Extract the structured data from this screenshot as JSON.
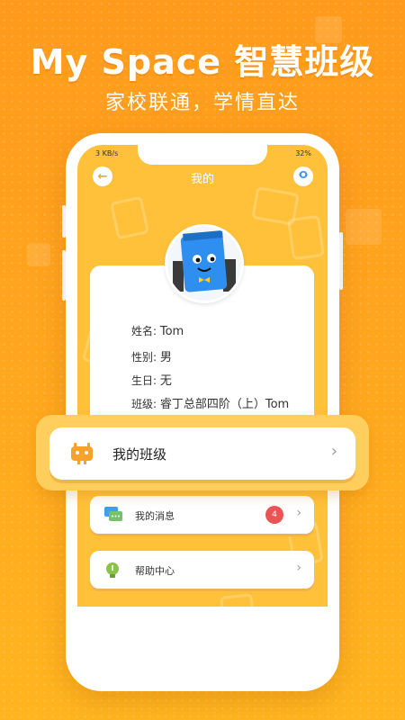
{
  "headline": "My Space 智慧班级",
  "subline": "家校联通，学情直达",
  "status": {
    "left": "3 KB/s",
    "right": "32%"
  },
  "nav": {
    "title": "我的",
    "back_icon": "back-arrow-icon",
    "settings_icon": "gear-icon"
  },
  "profile": {
    "name_label": "姓名:",
    "name_value": "Tom",
    "gender_label": "性别:",
    "gender_value": "男",
    "birthday_label": "生日:",
    "birthday_value": "无",
    "class_label": "班级:",
    "class_value": "睿丁总部四阶（上）Tom"
  },
  "menu": {
    "my_class": "我的班级",
    "my_messages": "我的消息",
    "messages_count": "4",
    "help_center": "帮助中心"
  },
  "colors": {
    "background": "#ffa51e",
    "screen": "#ffc13a",
    "accent": "#f7a22a",
    "badge": "#ea5455"
  }
}
